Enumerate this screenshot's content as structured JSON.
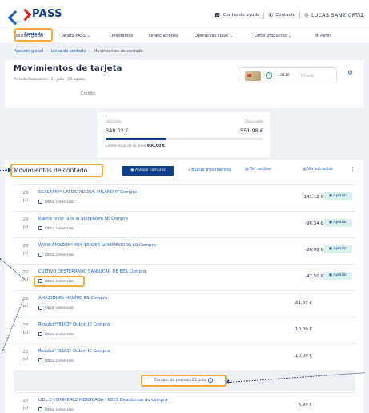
{
  "brand": {
    "name": "PASS",
    "sub": "Carrefour"
  },
  "top_links": {
    "help": "Centro de ayuda",
    "contact": "Contacto",
    "user": "LUCAS SANZ ORTIZ"
  },
  "nav": [
    "Posición global",
    "Tarjeta PASS",
    "Préstamos",
    "Financiaciones",
    "Operativas clave",
    "Otros productos",
    "Mi Perfil"
  ],
  "breadcrumb": {
    "item1": "Posición global",
    "item2": "Línea de contado",
    "current": "Movimientos de contado"
  },
  "header": {
    "title": "Movimientos de tarjeta",
    "period": "Periodo facturación: 21 julio - 20 agosto",
    "tab_contado": "Contado",
    "tab_credito": "Crédito",
    "card_number": "...8116",
    "card_holder": "TITULAR"
  },
  "summary": {
    "used_label": "Utilizado",
    "used_value": "348,02 €",
    "available_label": "Disponible",
    "available_value": "551,98 €",
    "limit_label": "Límite total de la línea",
    "limit_value": "900,00 €",
    "used_fraction": 0.387
  },
  "list": {
    "title": "Movimientos de contado",
    "btn_aplazar": "Aplazar compras",
    "btn_buscar": "Buscar movimientos",
    "btn_recibos": "Ver recibos",
    "btn_extractos": "Ver extractos",
    "aplazar_label": "Aplazar",
    "rows": [
      {
        "day": "23",
        "month": "jul",
        "desc": "SCALAPAY* LATOSTADORA. MILANO IT Compra",
        "cat": "Otros comercios",
        "amount": "-141,12 €",
        "aplazar": true
      },
      {
        "day": "22",
        "month": "jul",
        "desc": "Klarna fever labs in Stockholm SE Compra",
        "cat": "Otros comercios",
        "amount": "-96,34 €",
        "aplazar": true
      },
      {
        "day": "22",
        "month": "jul",
        "desc": "WWW.AMAZON* 404-150266 LUXEMBOURG LU Compra",
        "cat": "Otros comercios",
        "amount": "-26,99 €",
        "aplazar": true
      },
      {
        "day": "22",
        "month": "jul",
        "desc": "CULTIVO DESTERRADO SANLUCAR DE BES Compra",
        "cat": "Otros comercios",
        "amount": "-47,50 €",
        "aplazar": true
      },
      {
        "day": "22",
        "month": "jul",
        "desc": "AMAZON.ES MADRID ES Compra",
        "cat": "Otros comercios",
        "amount": "-21,07 €",
        "aplazar": false
      },
      {
        "day": "22",
        "month": "jul",
        "desc": "Revolut**8163* Dublin IE Compra",
        "cat": "Otros comercios",
        "amount": "-10,00 €",
        "aplazar": false
      },
      {
        "day": "22",
        "month": "jul",
        "desc": "Revolut**8163* Dublin IE Compra",
        "cat": "Otros comercios",
        "amount": "-10,00 €",
        "aplazar": false
      }
    ],
    "period_change": "Cambio de periodo 21 julio",
    "last_row": {
      "day": "20",
      "month": "jul",
      "desc": "LIDL E-COMMERCE MONTCADA I REES Devolucion de compra",
      "cat": "Otros comercios",
      "amount": "6,99 €"
    }
  },
  "colors": {
    "primary": "#0e3d8a",
    "link": "#1d5ec9",
    "highlight": "#f5a83a",
    "aplazar_bg": "#d9f2ee"
  }
}
